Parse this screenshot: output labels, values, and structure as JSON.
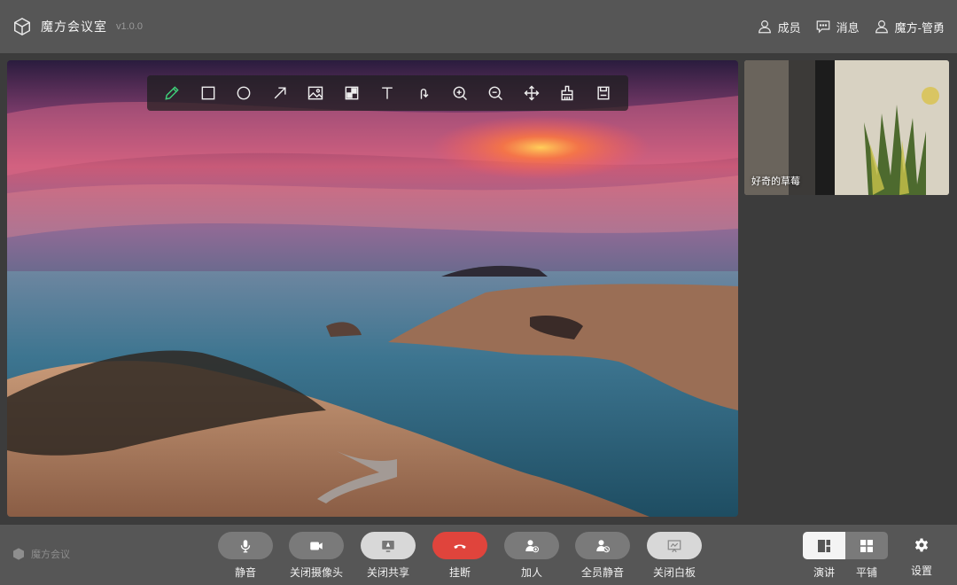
{
  "header": {
    "app_title": "魔方会议室",
    "version": "v1.0.0",
    "members_label": "成员",
    "messages_label": "消息",
    "user_label": "魔方-管勇"
  },
  "toolbar": {
    "tools": [
      "pencil-icon",
      "rectangle-icon",
      "circle-icon",
      "arrow-icon",
      "image-icon",
      "mosaic-icon",
      "text-icon",
      "undo-icon",
      "zoom-in-icon",
      "zoom-out-icon",
      "move-icon",
      "eraser-icon",
      "save-icon"
    ],
    "active_tool": "pencil-icon",
    "active_color": "#3fd07a"
  },
  "participants": [
    {
      "name": "好奇的草莓"
    }
  ],
  "footer": {
    "brand_label": "魔方会议",
    "mute_label": "静音",
    "camera_label": "关闭摄像头",
    "share_label": "关闭共享",
    "hangup_label": "挂断",
    "add_label": "加人",
    "mute_all_label": "全员静音",
    "whiteboard_label": "关闭白板",
    "speaker_label": "演讲",
    "tile_label": "平铺",
    "settings_label": "设置"
  },
  "colors": {
    "hangup": "#e0443c",
    "accent_green": "#3fd07a",
    "bar_bg": "#565656"
  }
}
